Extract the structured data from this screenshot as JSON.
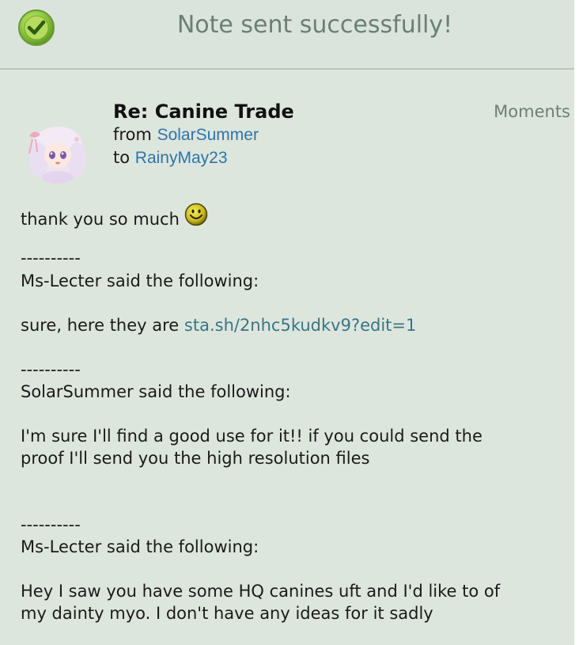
{
  "banner": {
    "message": "Note sent successfully!",
    "icon": "check-circle-icon",
    "icon_color": "#8cc63f"
  },
  "note": {
    "subject": "Re: Canine Trade",
    "timestamp": "Moments",
    "from_label": "from",
    "from_user": "SolarSummer",
    "to_label": "to",
    "to_user": "RainyMay23",
    "avatar": "avatar-image",
    "link_color": "#2f74a8"
  },
  "body": {
    "greeting": "thank you so much",
    "emoji": "smiley-emoji-icon",
    "sep1": "----------",
    "quote1_header": "Ms-Lecter said the following:",
    "quote1_text": "sure, here they are",
    "quote1_link": "sta.sh/2nhc5kudkv9?edit=1",
    "sep2": "----------",
    "quote2_header": "SolarSummer said the following:",
    "quote2_line1": "I'm sure I'll find a good use for it!! if you could send the",
    "quote2_line2": "proof I'll send you the high resolution files",
    "sep3": "----------",
    "quote3_header": "Ms-Lecter said the following:",
    "quote3_line1": "Hey I saw you have some HQ canines uft and I'd like to of",
    "quote3_line2": "my dainty myo. I don't have any ideas for it sadly"
  }
}
